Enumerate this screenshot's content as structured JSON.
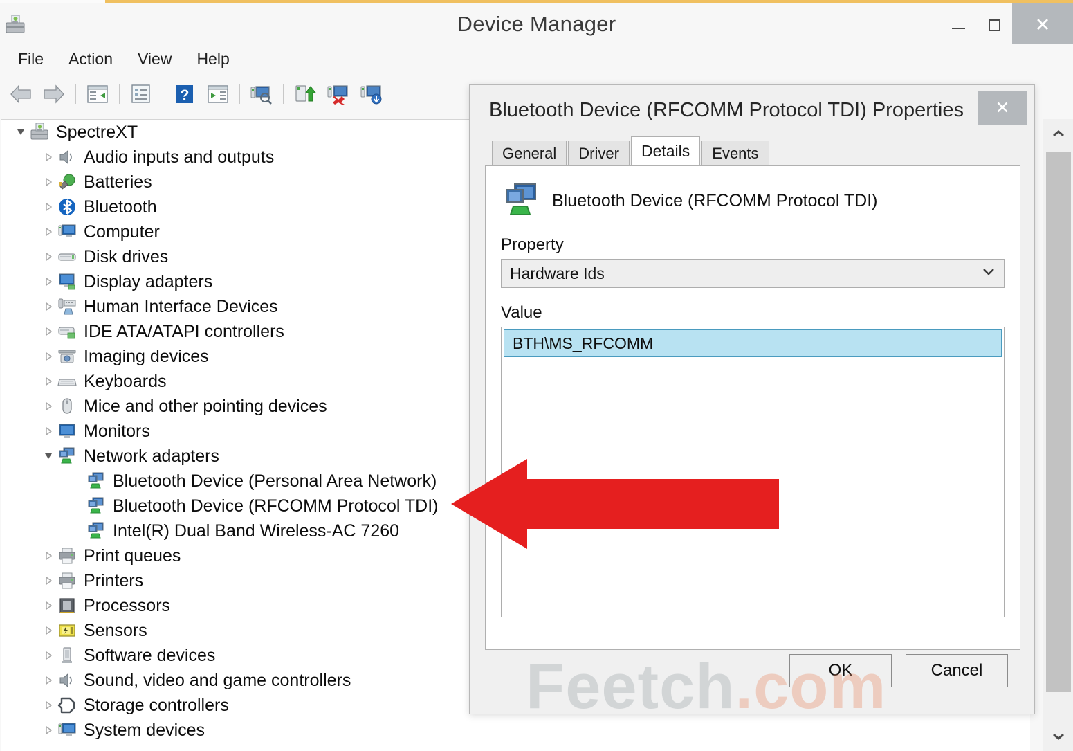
{
  "window": {
    "title": "Device Manager",
    "icon": "device-manager-icon",
    "accent_color": "#f0c060",
    "controls": {
      "minimize": "–",
      "maximize": "□",
      "close": "✕"
    }
  },
  "menubar": {
    "items": [
      {
        "label": "File"
      },
      {
        "label": "Action"
      },
      {
        "label": "View"
      },
      {
        "label": "Help"
      }
    ]
  },
  "toolbar": {
    "buttons": [
      {
        "icon": "back-arrow-icon",
        "tooltip": "Back"
      },
      {
        "icon": "forward-arrow-icon",
        "tooltip": "Forward"
      },
      {
        "icon": "show-hide-console-tree-icon",
        "tooltip": "Show/Hide Console Tree"
      },
      {
        "icon": "properties-icon",
        "tooltip": "Properties"
      },
      {
        "icon": "help-icon",
        "tooltip": "Help"
      },
      {
        "icon": "show-hide-action-pane-icon",
        "tooltip": "Show/Hide Action Pane"
      },
      {
        "icon": "scan-for-hardware-changes-icon",
        "tooltip": "Scan for hardware changes"
      },
      {
        "icon": "update-driver-icon",
        "tooltip": "Update Driver Software"
      },
      {
        "icon": "uninstall-device-icon",
        "tooltip": "Uninstall device"
      },
      {
        "icon": "disable-device-icon",
        "tooltip": "Disable device"
      }
    ]
  },
  "tree": {
    "nodes": [
      {
        "label": "SpectreXT",
        "level": 0,
        "expanded": true,
        "icon": "computer-root-icon",
        "twisty": "expanded"
      },
      {
        "label": "Audio inputs and outputs",
        "level": 1,
        "icon": "speaker-icon",
        "twisty": "collapsed"
      },
      {
        "label": "Batteries",
        "level": 1,
        "icon": "battery-icon",
        "twisty": "collapsed"
      },
      {
        "label": "Bluetooth",
        "level": 1,
        "icon": "bluetooth-icon",
        "twisty": "collapsed"
      },
      {
        "label": "Computer",
        "level": 1,
        "icon": "computer-icon",
        "twisty": "collapsed"
      },
      {
        "label": "Disk drives",
        "level": 1,
        "icon": "disk-drive-icon",
        "twisty": "collapsed"
      },
      {
        "label": "Display adapters",
        "level": 1,
        "icon": "display-adapter-icon",
        "twisty": "collapsed"
      },
      {
        "label": "Human Interface Devices",
        "level": 1,
        "icon": "hid-icon",
        "twisty": "collapsed"
      },
      {
        "label": "IDE ATA/ATAPI controllers",
        "level": 1,
        "icon": "ide-controller-icon",
        "twisty": "collapsed"
      },
      {
        "label": "Imaging devices",
        "level": 1,
        "icon": "camera-icon",
        "twisty": "collapsed"
      },
      {
        "label": "Keyboards",
        "level": 1,
        "icon": "keyboard-icon",
        "twisty": "collapsed"
      },
      {
        "label": "Mice and other pointing devices",
        "level": 1,
        "icon": "mouse-icon",
        "twisty": "collapsed"
      },
      {
        "label": "Monitors",
        "level": 1,
        "icon": "monitor-icon",
        "twisty": "collapsed"
      },
      {
        "label": "Network adapters",
        "level": 1,
        "expanded": true,
        "icon": "network-adapter-icon",
        "twisty": "expanded"
      },
      {
        "label": "Bluetooth Device (Personal Area Network)",
        "level": 2,
        "icon": "network-adapter-icon",
        "twisty": "none"
      },
      {
        "label": "Bluetooth Device (RFCOMM Protocol TDI)",
        "level": 2,
        "icon": "network-adapter-icon",
        "twisty": "none"
      },
      {
        "label": "Intel(R) Dual Band Wireless-AC 7260",
        "level": 2,
        "icon": "network-adapter-icon",
        "twisty": "none"
      },
      {
        "label": "Print queues",
        "level": 1,
        "icon": "printer-icon",
        "twisty": "collapsed"
      },
      {
        "label": "Printers",
        "level": 1,
        "icon": "printer-icon",
        "twisty": "collapsed"
      },
      {
        "label": "Processors",
        "level": 1,
        "icon": "processor-icon",
        "twisty": "collapsed"
      },
      {
        "label": "Sensors",
        "level": 1,
        "icon": "sensor-icon",
        "twisty": "collapsed"
      },
      {
        "label": "Software devices",
        "level": 1,
        "icon": "software-device-icon",
        "twisty": "collapsed"
      },
      {
        "label": "Sound, video and game controllers",
        "level": 1,
        "icon": "speaker-icon",
        "twisty": "collapsed"
      },
      {
        "label": "Storage controllers",
        "level": 1,
        "icon": "storage-controller-icon",
        "twisty": "collapsed"
      },
      {
        "label": "System devices",
        "level": 1,
        "icon": "computer-icon",
        "twisty": "collapsed"
      }
    ]
  },
  "dialog": {
    "title": "Bluetooth Device (RFCOMM Protocol TDI) Properties",
    "close_label": "✕",
    "tabs": [
      {
        "label": "General",
        "active": false
      },
      {
        "label": "Driver",
        "active": false
      },
      {
        "label": "Details",
        "active": true
      },
      {
        "label": "Events",
        "active": false
      }
    ],
    "device_name": "Bluetooth Device (RFCOMM Protocol TDI)",
    "device_icon": "network-adapter-icon",
    "property_label": "Property",
    "property_value": "Hardware Ids",
    "value_label": "Value",
    "values": [
      {
        "text": "BTH\\MS_RFCOMM",
        "selected": true
      }
    ],
    "buttons": {
      "ok": "OK",
      "cancel": "Cancel"
    },
    "selection_color": "#b8e2f2"
  },
  "annotation": {
    "arrow": {
      "icon": "red-left-arrow-icon",
      "color": "#e51f1f",
      "direction": "left"
    }
  },
  "watermark": {
    "part1": "Feetch",
    "part2": ".com",
    "color1": "#9aa2a6",
    "color2": "#e98a62"
  },
  "scrollbar": {
    "up_arrow": "▲",
    "down_arrow": "▼"
  }
}
